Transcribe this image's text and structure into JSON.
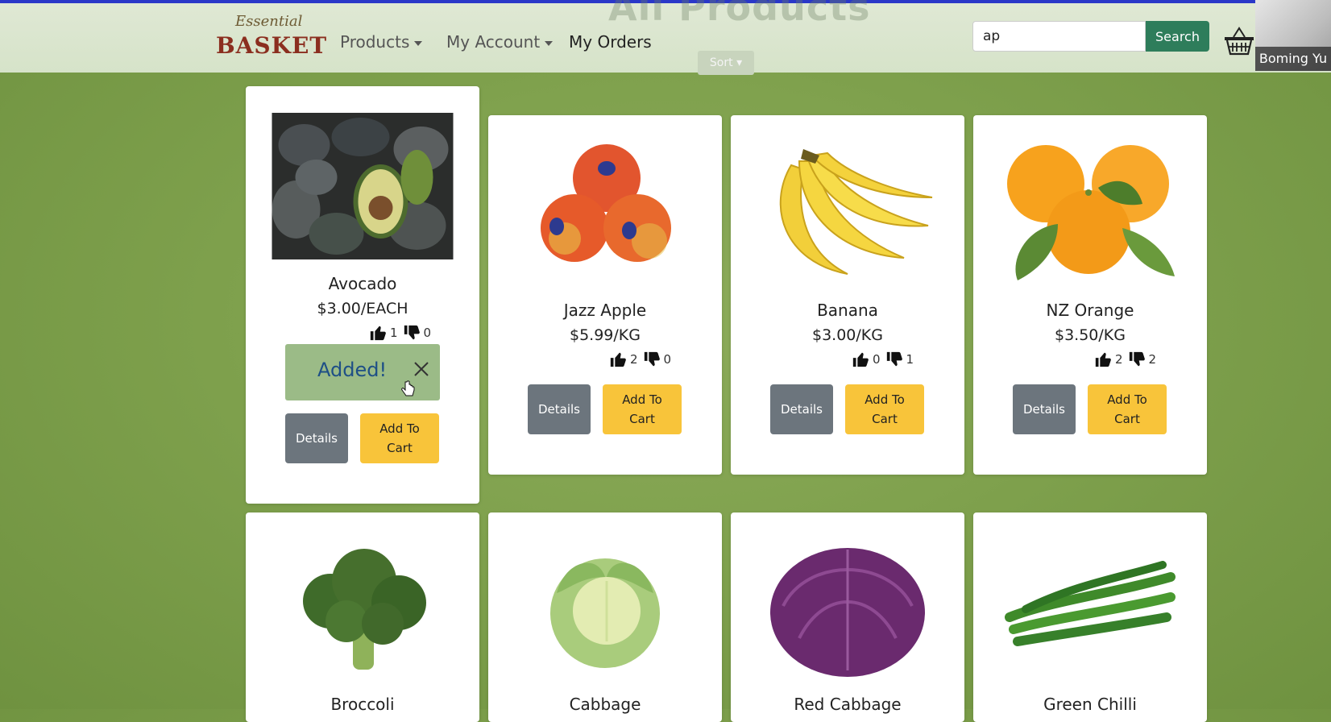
{
  "page": {
    "heading": "All Products"
  },
  "navbar": {
    "logo_top": "Essential",
    "logo_main": "BASKET",
    "items": [
      {
        "label": "Products",
        "dropdown": true
      },
      {
        "label": "My Account",
        "dropdown": true
      },
      {
        "label": "My Orders",
        "dropdown": false
      }
    ],
    "sort_label": "Sort",
    "search": {
      "value": "ap",
      "button_label": "Search"
    },
    "cart_icon": "basket-icon"
  },
  "webcam": {
    "name": "Boming Yu"
  },
  "toast": {
    "text": "Added!",
    "close_icon": "close-icon"
  },
  "buttons": {
    "details": "Details",
    "add_to_cart": "Add To Cart"
  },
  "products": [
    {
      "name": "Avocado",
      "price": "$3.00/EACH",
      "likes": "1",
      "dislikes": "0",
      "image": "avocado"
    },
    {
      "name": "Jazz Apple",
      "price": "$5.99/KG",
      "likes": "2",
      "dislikes": "0",
      "image": "apple"
    },
    {
      "name": "Banana",
      "price": "$3.00/KG",
      "likes": "0",
      "dislikes": "1",
      "image": "banana"
    },
    {
      "name": "NZ Orange",
      "price": "$3.50/KG",
      "likes": "2",
      "dislikes": "2",
      "image": "orange"
    },
    {
      "name": "Broccoli",
      "image": "broccoli"
    },
    {
      "name": "Cabbage",
      "image": "cabbage"
    },
    {
      "name": "Red Cabbage",
      "image": "red-cabbage"
    },
    {
      "name": "Green Chilli",
      "image": "green-chilli"
    }
  ],
  "colors": {
    "search_button": "#2e7d5b",
    "add_to_cart": "#f8c43a",
    "details": "#6c757d",
    "toast_bg": "#9bbb87",
    "toast_text": "#1e4f86",
    "logo_red": "#8b2e1f"
  }
}
